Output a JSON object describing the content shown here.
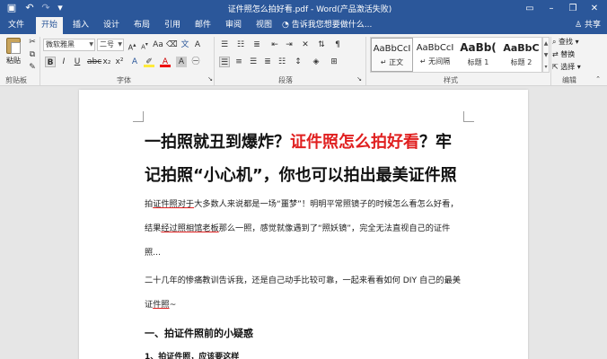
{
  "titlebar": {
    "title": "证件照怎么拍好看.pdf - Word(产品激活失败)",
    "save_icon": "save-icon",
    "undo_icon": "undo-icon",
    "redo_icon": "redo-icon",
    "customize_icon": "customize-icon",
    "window_controls": [
      "ribbon-options-icon",
      "minimize-icon",
      "restore-icon",
      "close-icon"
    ]
  },
  "tabs": [
    {
      "label": "文件",
      "active": false
    },
    {
      "label": "开始",
      "active": true
    },
    {
      "label": "插入",
      "active": false
    },
    {
      "label": "设计",
      "active": false
    },
    {
      "label": "布局",
      "active": false
    },
    {
      "label": "引用",
      "active": false
    },
    {
      "label": "邮件",
      "active": false
    },
    {
      "label": "审阅",
      "active": false
    },
    {
      "label": "视图",
      "active": false
    }
  ],
  "tellme": "告诉我您想要做什么...",
  "share": "共享",
  "ribbon": {
    "clipboard": {
      "paste_label": "粘贴",
      "group_label": "剪贴板"
    },
    "font": {
      "font_name": "微软雅黑",
      "font_size": "二号",
      "group_label": "字体",
      "bold": "B",
      "italic": "I",
      "underline": "U"
    },
    "paragraph": {
      "group_label": "段落"
    },
    "styles": {
      "group_label": "样式",
      "items": [
        {
          "sample": "AaBbCcI",
          "name": "↵ 正文"
        },
        {
          "sample": "AaBbCcI",
          "name": "↵ 无间隔"
        },
        {
          "sample": "AaBb(",
          "name": "标题 1"
        },
        {
          "sample": "AaBbC",
          "name": "标题 2"
        }
      ]
    },
    "editing": {
      "group_label": "编辑",
      "find": "查找",
      "replace": "替换",
      "select": "选择"
    }
  },
  "document": {
    "heading_parts": {
      "p1": "一拍照就丑到爆炸？",
      "p2_red": "证件照怎么拍好看",
      "p3": "？牢记拍照“小心机”，你也可以拍出最美证件照"
    },
    "para1_a": "拍",
    "para1_u": "证件照对于",
    "para1_b": "大多数人来说都是一场“噩梦”！明明平常照镜子的时候怎么看怎么好看，结果",
    "para1_u2": "经过照相馆老板",
    "para1_c": "那么一照，感觉就像遇到了“照妖镜”，完全无法直视自己的证件照...",
    "para2_a": "二十几年的惨痛教训告诉我，还是自己动手比较可靠，一起来看看如何 DIY 自己的最美证",
    "para2_u": "件照",
    "para2_b": "~",
    "section1": "一、拍证件照前的小疑惑",
    "sub1": "1、拍证件照，应该要这样"
  }
}
